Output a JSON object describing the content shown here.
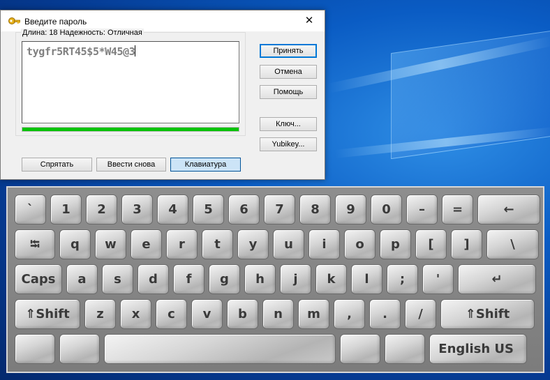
{
  "dialog": {
    "title": "Введите пароль",
    "close": "✕",
    "info": "Длина: 18   Надежность: Отличная",
    "password": "tygfr5RT45$5*W45@3",
    "quality_fraction": 1.0,
    "buttons": {
      "accept": "Принять",
      "cancel": "Отмена",
      "help": "Помощь",
      "key": "Ключ...",
      "yubikey": "Yubikey...",
      "hide": "Спрятать",
      "reenter": "Ввести снова",
      "keyboard": "Клавиатура"
    }
  },
  "keyboard": {
    "row1": [
      "`",
      "1",
      "2",
      "3",
      "4",
      "5",
      "6",
      "7",
      "8",
      "9",
      "0",
      "–",
      "=",
      "←"
    ],
    "row2": [
      "⭾",
      "q",
      "w",
      "e",
      "r",
      "t",
      "y",
      "u",
      "i",
      "o",
      "p",
      "[",
      "]",
      "\\"
    ],
    "row3": [
      "Caps",
      "a",
      "s",
      "d",
      "f",
      "g",
      "h",
      "j",
      "k",
      "l",
      ";",
      "'",
      "↵"
    ],
    "row4": [
      "⇑Shift",
      "z",
      "x",
      "c",
      "v",
      "b",
      "n",
      "m",
      ",",
      ".",
      "/",
      "⇑Shift"
    ],
    "row5": [
      "",
      "",
      "",
      "",
      "",
      "English US"
    ]
  },
  "colors": {
    "quality": "#06c306",
    "default_button_border": "#0078d7"
  }
}
